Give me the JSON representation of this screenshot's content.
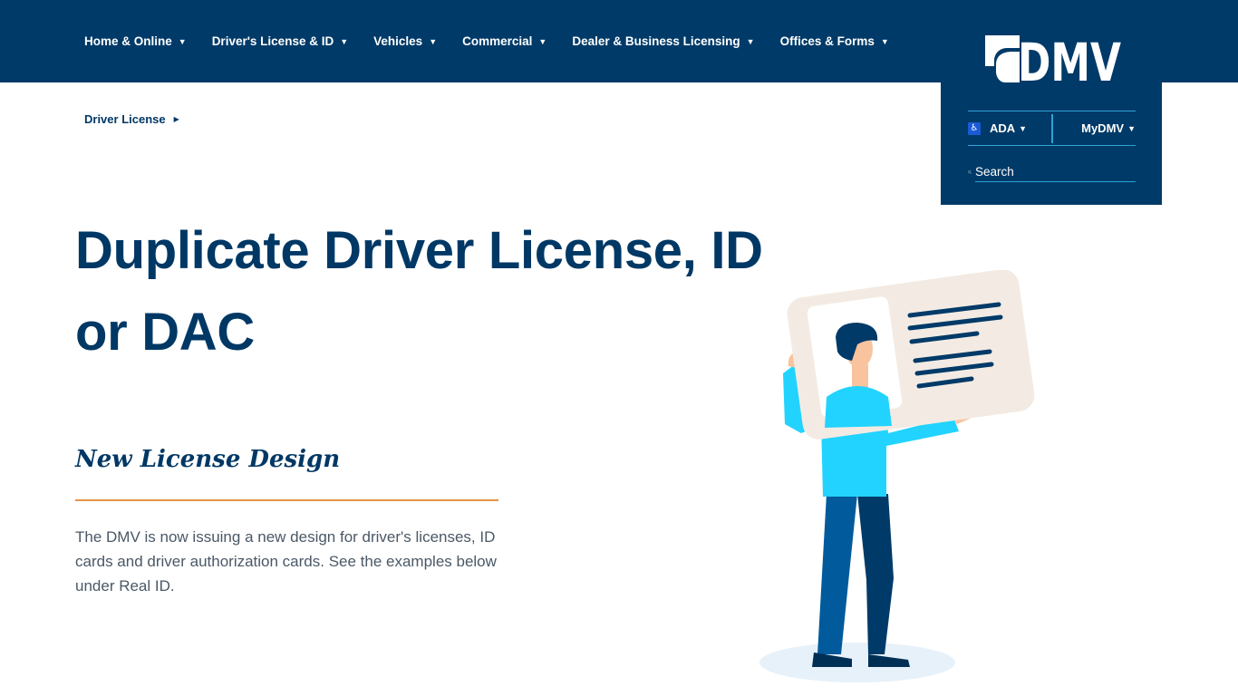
{
  "nav": {
    "items": [
      {
        "label": "Home & Online"
      },
      {
        "label": "Driver's License & ID"
      },
      {
        "label": "Vehicles"
      },
      {
        "label": "Commercial"
      },
      {
        "label": "Dealer & Business Licensing"
      },
      {
        "label": "Offices & Forms"
      }
    ]
  },
  "logo": {
    "text": "DMV"
  },
  "utility": {
    "ada_label": "ADA",
    "mydmv_label": "MyDMV",
    "search_placeholder": "Search"
  },
  "breadcrumb": {
    "items": [
      {
        "label": "Driver License"
      }
    ]
  },
  "main": {
    "title_line1": "Duplicate Driver License, ID",
    "title_line2": "or DAC",
    "section_heading": "New License Design",
    "body_text": "The DMV is now issuing a new design for driver's licenses, ID cards and driver authorization cards. See the examples below under Real ID."
  },
  "colors": {
    "brand_navy": "#003a68",
    "accent_orange": "#e59445",
    "accent_cyan": "#2ea3d4"
  }
}
